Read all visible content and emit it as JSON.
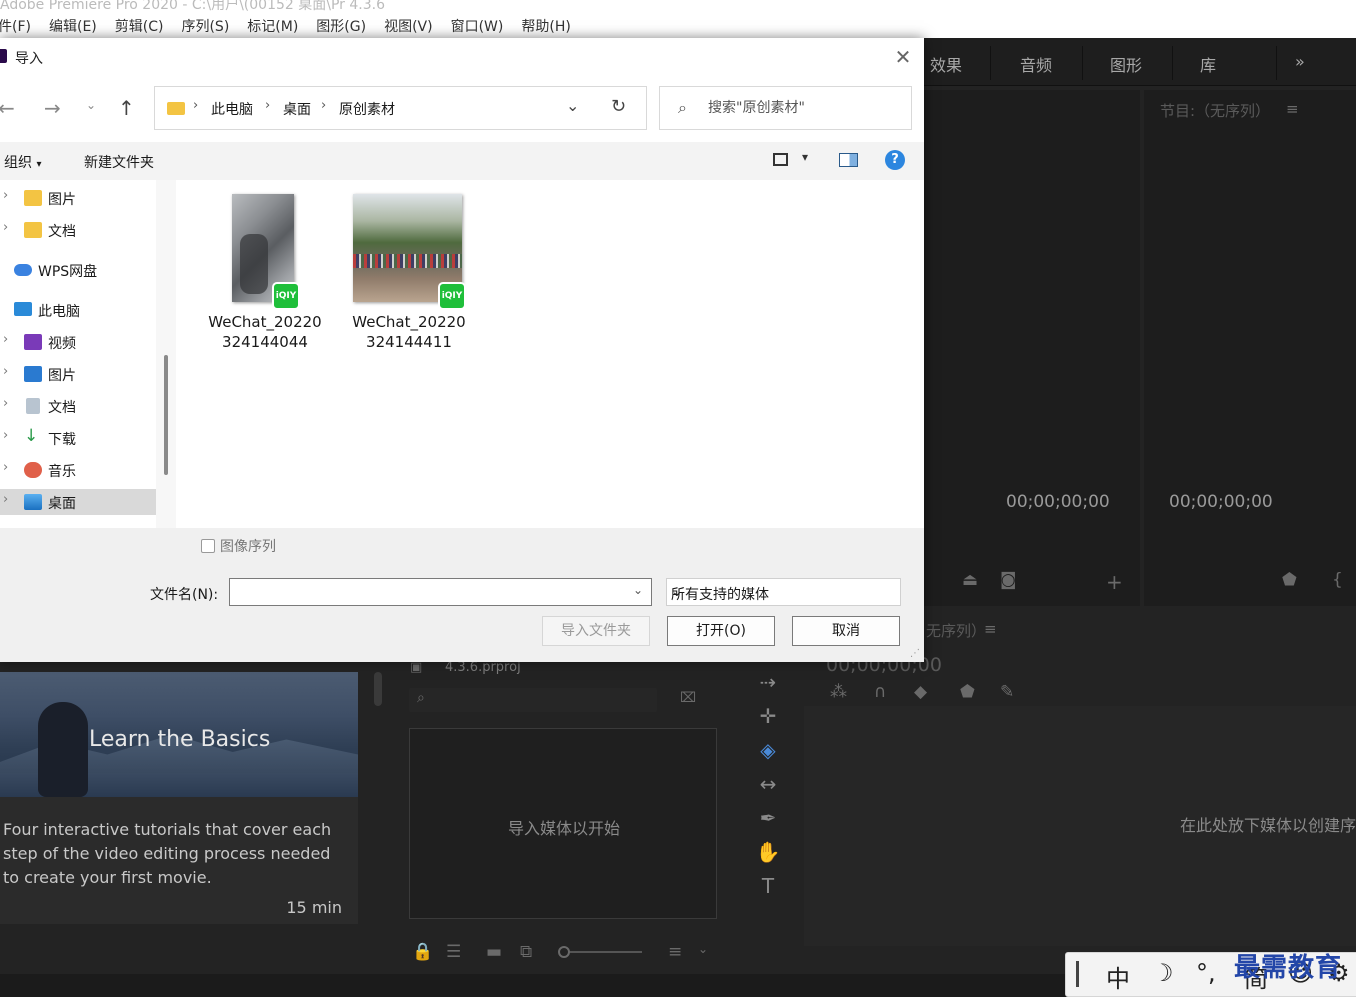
{
  "app": {
    "titlebar_text": "Adobe Premiere Pro 2020 - C:\\用户\\(00152 桌面\\Pr 4.3.6",
    "menu": [
      "件(F)",
      "编辑(E)",
      "剪辑(C)",
      "序列(S)",
      "标记(M)",
      "图形(G)",
      "视图(V)",
      "窗口(W)",
      "帮助(H)"
    ]
  },
  "premiere": {
    "tabs": [
      "效果",
      "音频",
      "图形",
      "库"
    ],
    "tabs_overflow": "»",
    "program_title": "节目:（无序列）",
    "source_timecode": "00;00;00;00",
    "program_timecode": "00;00;00;00",
    "timeline_title": "无序列）",
    "timeline_timecode": "00;00;00;00",
    "project_file": "4.3.6.prproj",
    "project_drop_hint": "导入媒体以开始",
    "timeline_drop_hint": "在此处放下媒体以创建序",
    "learn": {
      "title": "Learn the Basics",
      "description": "Four interactive tutorials that cover each step of the video editing process needed to create your first movie.",
      "duration": "15 min"
    }
  },
  "dialog": {
    "title": "导入",
    "breadcrumb": [
      "此电脑",
      "桌面",
      "原创素材"
    ],
    "search_placeholder": "搜索\"原创素材\"",
    "commands": {
      "organize": "组织",
      "new_folder": "新建文件夹"
    },
    "nav_items": [
      {
        "label": "图片",
        "icon": "folder-icon"
      },
      {
        "label": "文档",
        "icon": "folder-icon"
      },
      {
        "label": "WPS网盘",
        "icon": "cloud-icon"
      },
      {
        "label": "此电脑",
        "icon": "pc-icon"
      },
      {
        "label": "视频",
        "icon": "video-icon"
      },
      {
        "label": "图片",
        "icon": "picture-icon"
      },
      {
        "label": "文档",
        "icon": "document-icon"
      },
      {
        "label": "下载",
        "icon": "download-icon"
      },
      {
        "label": "音乐",
        "icon": "music-icon"
      },
      {
        "label": "桌面",
        "icon": "desktop-icon",
        "selected": true
      }
    ],
    "files": [
      {
        "name_line1": "WeChat_20220",
        "name_line2": "324144044",
        "badge": "iQIY"
      },
      {
        "name_line1": "WeChat_20220",
        "name_line2": "324144411",
        "badge": "iQIY"
      }
    ],
    "image_sequence_label": "图像序列",
    "filename_label": "文件名(N):",
    "filename_value": "",
    "filetype_value": "所有支持的媒体",
    "buttons": {
      "import_folder": "导入文件夹",
      "open": "打开(O)",
      "cancel": "取消"
    }
  },
  "ime": {
    "mode": "中",
    "moon": "☽",
    "punct": "°,",
    "simplified": "简"
  },
  "watermark": "最需教育",
  "colors": {
    "accent_blue": "#2c86df",
    "iqiyi_green": "#1fbf3a",
    "premiere_bg": "#232323"
  }
}
